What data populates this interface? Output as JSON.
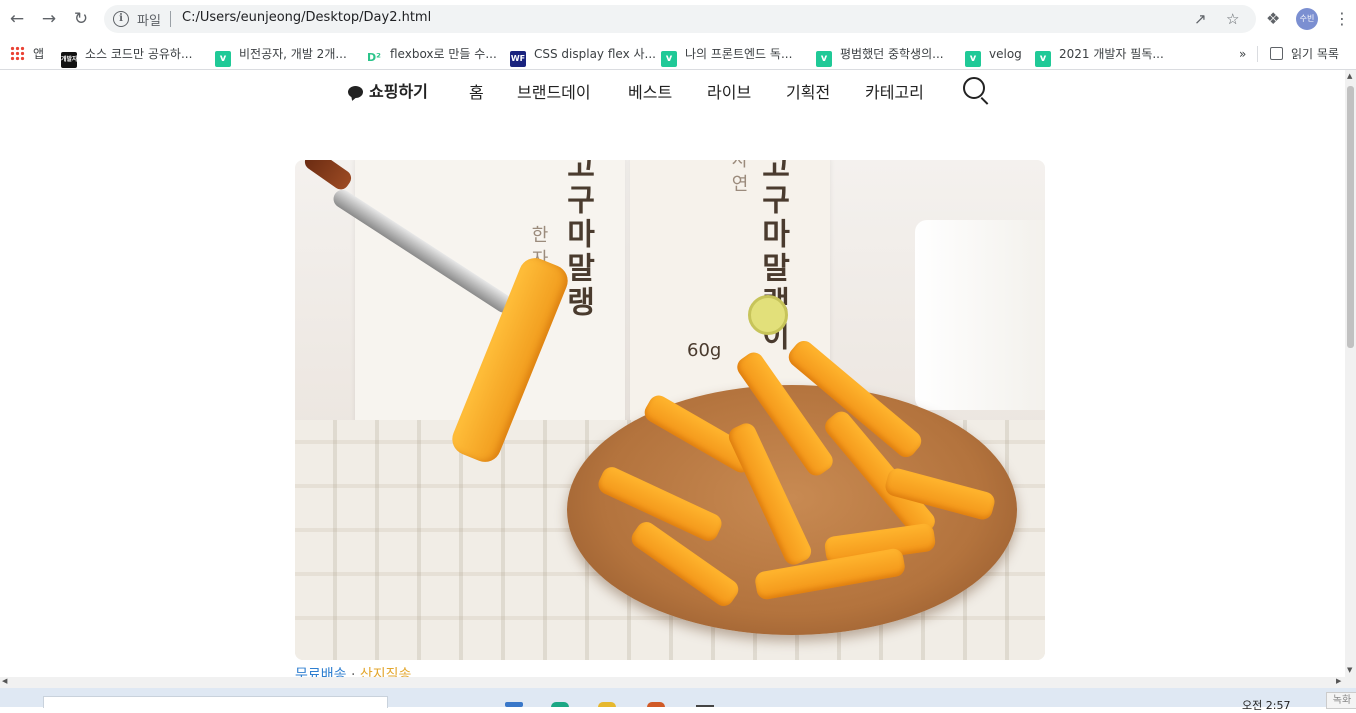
{
  "browser": {
    "back_icon": "arrow-left-icon",
    "forward_icon": "arrow-right-icon",
    "reload_icon": "reload-icon",
    "address": {
      "scheme_label": "파일",
      "url": "C:/Users/eunjeong/Desktop/Day2.html"
    },
    "avatar_text": "수빈"
  },
  "bookmarks": {
    "apps_label": "앱",
    "items": [
      {
        "label": "소스 코드만 공유하...",
        "icon": "blk",
        "icon_text": "개발자"
      },
      {
        "label": "비전공자, 개발 2개...",
        "icon": "v",
        "icon_text": "v"
      },
      {
        "label": "flexbox로 만들 수...",
        "icon": "d2",
        "icon_text": "D²"
      },
      {
        "label": "CSS display flex 사...",
        "icon": "w",
        "icon_text": "WF"
      },
      {
        "label": "나의 프론트엔드 독...",
        "icon": "v",
        "icon_text": "v"
      },
      {
        "label": "평범했던 중학생의...",
        "icon": "v",
        "icon_text": "v"
      },
      {
        "label": "velog",
        "icon": "v",
        "icon_text": "v"
      },
      {
        "label": "2021 개발자 필독...",
        "icon": "v",
        "icon_text": "v"
      }
    ],
    "more_label": "»",
    "reading_list_label": "읽기 목록"
  },
  "site": {
    "logo": "쇼핑하기",
    "nav": [
      "홈",
      "브랜드데이",
      "베스트",
      "라이브",
      "기획전",
      "카테고리"
    ]
  },
  "product_image": {
    "package_text_1": "고구마말랭",
    "package_sub_1": "한자연",
    "package_text_2": "고구마말랭이",
    "package_sub_2": "자연",
    "package_weight": "60g"
  },
  "tags": {
    "free_shipping": "무료배송",
    "separator": "·",
    "direct": "산지직송"
  },
  "taskbar": {
    "time": "오전 2:57",
    "corner_label": "녹화"
  }
}
